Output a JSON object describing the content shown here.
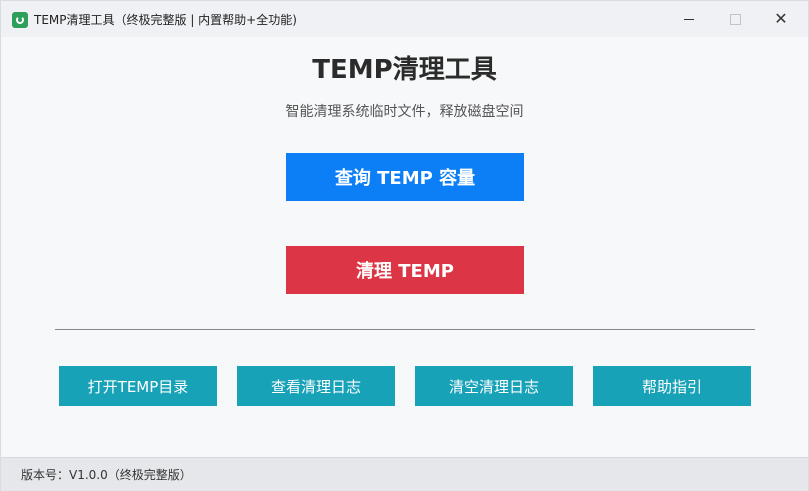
{
  "window": {
    "title": "TEMP清理工具（终极完整版 | 内置帮助+全功能)",
    "controls": {
      "minimize": "minimize",
      "maximize": "maximize",
      "close": "✕"
    },
    "icon": "recycle-app-icon"
  },
  "main": {
    "heading": "TEMP清理工具",
    "subtitle": "智能清理系统临时文件，释放磁盘空间",
    "query_button": "查询 TEMP 容量",
    "clean_button": "清理 TEMP"
  },
  "actions": [
    "打开TEMP目录",
    "查看清理日志",
    "清空清理日志",
    "帮助指引"
  ],
  "status": {
    "version": "版本号：V1.0.0（终极完整版）"
  },
  "colors": {
    "query": "#0d7ff6",
    "clean": "#dc3545",
    "secondary": "#17a2b8"
  }
}
